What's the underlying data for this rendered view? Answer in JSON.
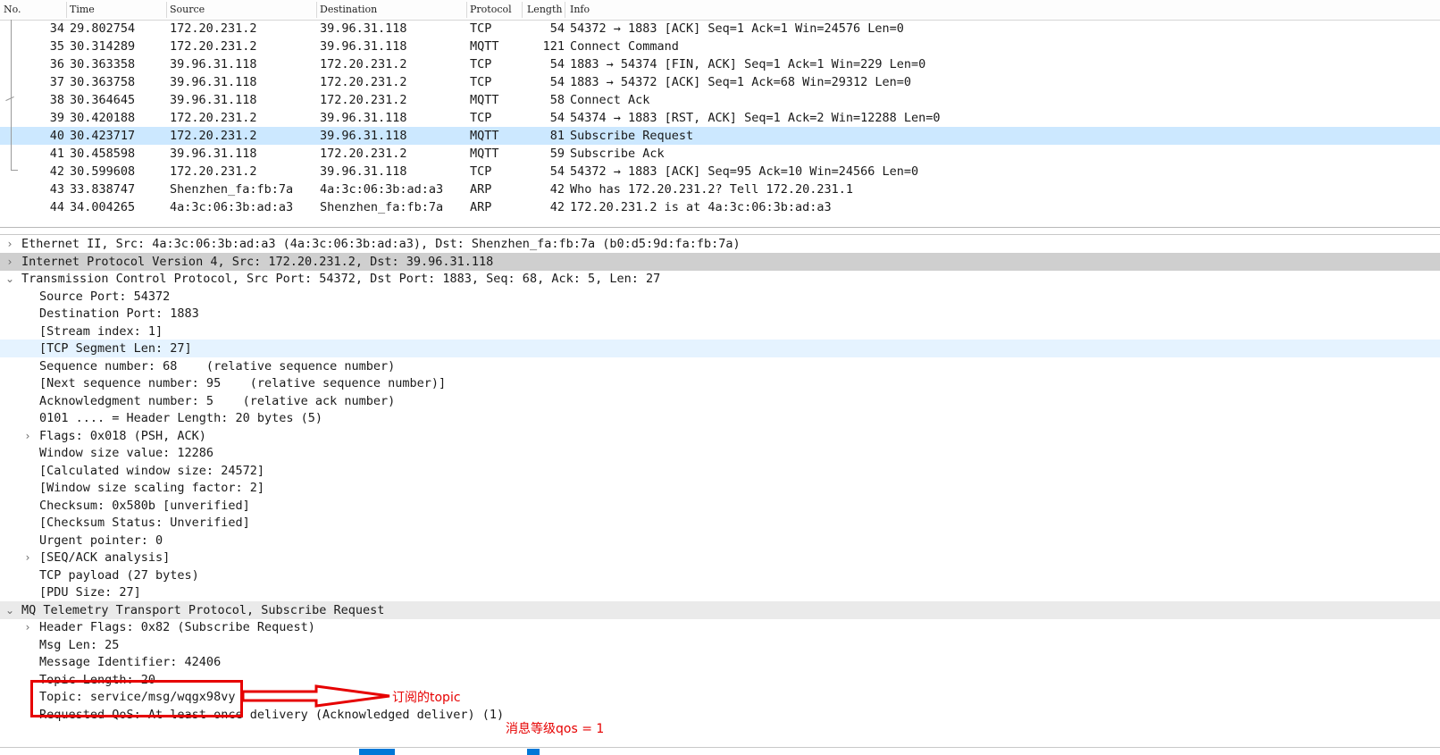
{
  "packet_list": {
    "columns": [
      "No.",
      "Time",
      "Source",
      "Destination",
      "Protocol",
      "Length",
      "Info"
    ],
    "selected_no": "40",
    "rows": [
      {
        "no": "34",
        "time": "29.802754",
        "src": "172.20.231.2",
        "dst": "39.96.31.118",
        "proto": "TCP",
        "len": "54",
        "info": "54372 → 1883 [ACK] Seq=1 Ack=1 Win=24576 Len=0"
      },
      {
        "no": "35",
        "time": "30.314289",
        "src": "172.20.231.2",
        "dst": "39.96.31.118",
        "proto": "MQTT",
        "len": "121",
        "info": "Connect Command"
      },
      {
        "no": "36",
        "time": "30.363358",
        "src": "39.96.31.118",
        "dst": "172.20.231.2",
        "proto": "TCP",
        "len": "54",
        "info": "1883 → 54374 [FIN, ACK] Seq=1 Ack=1 Win=229 Len=0"
      },
      {
        "no": "37",
        "time": "30.363758",
        "src": "39.96.31.118",
        "dst": "172.20.231.2",
        "proto": "TCP",
        "len": "54",
        "info": "1883 → 54372 [ACK] Seq=1 Ack=68 Win=29312 Len=0"
      },
      {
        "no": "38",
        "time": "30.364645",
        "src": "39.96.31.118",
        "dst": "172.20.231.2",
        "proto": "MQTT",
        "len": "58",
        "info": "Connect Ack"
      },
      {
        "no": "39",
        "time": "30.420188",
        "src": "172.20.231.2",
        "dst": "39.96.31.118",
        "proto": "TCP",
        "len": "54",
        "info": "54374 → 1883 [RST, ACK] Seq=1 Ack=2 Win=12288 Len=0"
      },
      {
        "no": "40",
        "time": "30.423717",
        "src": "172.20.231.2",
        "dst": "39.96.31.118",
        "proto": "MQTT",
        "len": "81",
        "info": "Subscribe Request"
      },
      {
        "no": "41",
        "time": "30.458598",
        "src": "39.96.31.118",
        "dst": "172.20.231.2",
        "proto": "MQTT",
        "len": "59",
        "info": "Subscribe Ack"
      },
      {
        "no": "42",
        "time": "30.599608",
        "src": "172.20.231.2",
        "dst": "39.96.31.118",
        "proto": "TCP",
        "len": "54",
        "info": "54372 → 1883 [ACK] Seq=95 Ack=10 Win=24566 Len=0"
      },
      {
        "no": "43",
        "time": "33.838747",
        "src": "Shenzhen_fa:fb:7a",
        "dst": "4a:3c:06:3b:ad:a3",
        "proto": "ARP",
        "len": "42",
        "info": "Who has 172.20.231.2? Tell 172.20.231.1"
      },
      {
        "no": "44",
        "time": "34.004265",
        "src": "4a:3c:06:3b:ad:a3",
        "dst": "Shenzhen_fa:fb:7a",
        "proto": "ARP",
        "len": "42",
        "info": "172.20.231.2 is at 4a:3c:06:3b:ad:a3"
      }
    ]
  },
  "details": {
    "rows": [
      {
        "text": "Ethernet II, Src: 4a:3c:06:3b:ad:a3 (4a:3c:06:3b:ad:a3), Dst: Shenzhen_fa:fb:7a (b0:d5:9d:fa:fb:7a)",
        "level": 0,
        "arrow": "›",
        "style": ""
      },
      {
        "text": "Internet Protocol Version 4, Src: 172.20.231.2, Dst: 39.96.31.118",
        "level": 0,
        "arrow": "›",
        "style": "ip"
      },
      {
        "text": "Transmission Control Protocol, Src Port: 54372, Dst Port: 1883, Seq: 68, Ack: 5, Len: 27",
        "level": 0,
        "arrow": "⌄",
        "style": ""
      },
      {
        "text": "Source Port: 54372",
        "level": 1,
        "arrow": "",
        "style": ""
      },
      {
        "text": "Destination Port: 1883",
        "level": 1,
        "arrow": "",
        "style": ""
      },
      {
        "text": "[Stream index: 1]",
        "level": 1,
        "arrow": "",
        "style": ""
      },
      {
        "text": "[TCP Segment Len: 27]",
        "level": 1,
        "arrow": "",
        "style": "field-sel"
      },
      {
        "text": "Sequence number: 68    (relative sequence number)",
        "level": 1,
        "arrow": "",
        "style": ""
      },
      {
        "text": "[Next sequence number: 95    (relative sequence number)]",
        "level": 1,
        "arrow": "",
        "style": ""
      },
      {
        "text": "Acknowledgment number: 5    (relative ack number)",
        "level": 1,
        "arrow": "",
        "style": ""
      },
      {
        "text": "0101 .... = Header Length: 20 bytes (5)",
        "level": 1,
        "arrow": "",
        "style": ""
      },
      {
        "text": "Flags: 0x018 (PSH, ACK)",
        "level": 1,
        "arrow": "›",
        "style": ""
      },
      {
        "text": "Window size value: 12286",
        "level": 1,
        "arrow": "",
        "style": ""
      },
      {
        "text": "[Calculated window size: 24572]",
        "level": 1,
        "arrow": "",
        "style": ""
      },
      {
        "text": "[Window size scaling factor: 2]",
        "level": 1,
        "arrow": "",
        "style": ""
      },
      {
        "text": "Checksum: 0x580b [unverified]",
        "level": 1,
        "arrow": "",
        "style": ""
      },
      {
        "text": "[Checksum Status: Unverified]",
        "level": 1,
        "arrow": "",
        "style": ""
      },
      {
        "text": "Urgent pointer: 0",
        "level": 1,
        "arrow": "",
        "style": ""
      },
      {
        "text": "[SEQ/ACK analysis]",
        "level": 1,
        "arrow": "›",
        "style": ""
      },
      {
        "text": "TCP payload (27 bytes)",
        "level": 1,
        "arrow": "",
        "style": ""
      },
      {
        "text": "[PDU Size: 27]",
        "level": 1,
        "arrow": "",
        "style": ""
      },
      {
        "text": "MQ Telemetry Transport Protocol, Subscribe Request",
        "level": 0,
        "arrow": "⌄",
        "style": "light"
      },
      {
        "text": "Header Flags: 0x82 (Subscribe Request)",
        "level": 1,
        "arrow": "›",
        "style": ""
      },
      {
        "text": "Msg Len: 25",
        "level": 1,
        "arrow": "",
        "style": ""
      },
      {
        "text": "Message Identifier: 42406",
        "level": 1,
        "arrow": "",
        "style": ""
      },
      {
        "text": "Topic Length: 20",
        "level": 1,
        "arrow": "",
        "style": ""
      },
      {
        "text": "Topic: service/msg/wqgx98vy",
        "level": 1,
        "arrow": "",
        "style": ""
      },
      {
        "text": "Requested QoS: At least once delivery (Acknowledged deliver) (1)",
        "level": 1,
        "arrow": "",
        "style": ""
      }
    ]
  },
  "annotations": {
    "topic_note": "订阅的topic",
    "qos_note": "消息等级qos = 1"
  },
  "colors": {
    "selected_row": "#cce8ff",
    "annotation_red": "#e60000",
    "ip_row": "#cfcfcf"
  }
}
